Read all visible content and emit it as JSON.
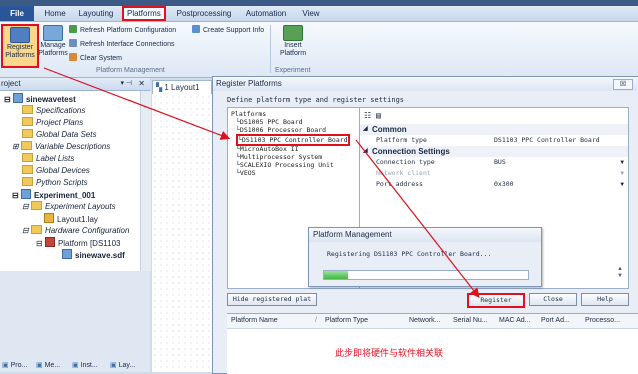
{
  "menubar": {
    "file": "File",
    "items": [
      "Home",
      "Layouting",
      "Platforms",
      "Postprocessing",
      "Automation",
      "View"
    ]
  },
  "ribbon": {
    "register_platforms": "Register\nPlatforms",
    "manage_platforms": "Manage\nPlatforms",
    "refresh_platform_config": "Refresh Platform Configuration",
    "create_support_info": "Create Support Info",
    "refresh_interface_connections": "Refresh Interface Connections",
    "clear_system": "Clear System",
    "insert_platform": "Insert\nPlatform",
    "group_platform_management": "Platform Management",
    "group_experiment": "Experiment"
  },
  "project_tree": {
    "header": "roject",
    "nodes": [
      {
        "label": "sinewavetest",
        "bold": true
      },
      {
        "label": "Specifications"
      },
      {
        "label": "Project Plans"
      },
      {
        "label": "Global Data Sets"
      },
      {
        "label": "Variable Descriptions"
      },
      {
        "label": "Label Lists"
      },
      {
        "label": "Global Devices"
      },
      {
        "label": "Python Scripts"
      },
      {
        "label": "Experiment_001",
        "bold": true
      },
      {
        "label": "Experiment Layouts"
      },
      {
        "label": "Layout1.lay"
      },
      {
        "label": "Hardware Configuration"
      },
      {
        "label": "Platform [DS1103"
      },
      {
        "label": "sinewave.sdf",
        "bold": true
      }
    ],
    "bottom_tabs": [
      "Pro...",
      "Me...",
      "Inst...",
      "Lay..."
    ]
  },
  "layout_tab": "1 Layout1",
  "dialog": {
    "title": "Register Platforms",
    "close": "☒",
    "subtitle": "Define platform type and register settings",
    "platforms_root": "Platforms",
    "platforms": [
      "DS1005 PPC Board",
      "DS1006 Processor Board",
      "DS1103 PPC Controller Board",
      "MicroAutoBox II",
      "Multiprocessor System",
      "SCALEXIO Processing Unit",
      "VEOS"
    ],
    "selected_platform": "DS1103 PPC Controller Board",
    "properties": {
      "common_label": "Common",
      "platform_type_label": "Platform type",
      "platform_type_value": "DS1103 PPC Controller Board",
      "connection_label": "Connection Settings",
      "connection_type_label": "Connection type",
      "connection_type_value": "BUS",
      "network_client_label": "Network client",
      "port_address_label": "Port address",
      "port_address_value": "0x300"
    },
    "buttons": {
      "hide_registered": "Hide registered plat",
      "register": "Register",
      "close": "Close",
      "help": "Help"
    },
    "grid_headers": [
      "Platform Name",
      "Platform Type",
      "Network...",
      "Serial Nu...",
      "MAC Ad...",
      "Port Ad...",
      "Processo..."
    ],
    "note": "此步即将硬件与软件相关联"
  },
  "progress_dialog": {
    "title": "Platform Management",
    "message": "Registering DS1103 PPC Controller Board...",
    "progress": 0.12
  },
  "colors": {
    "annotation_red": "#e0101e",
    "file_blue": "#2a5596",
    "progress_green": "#3fb743"
  }
}
